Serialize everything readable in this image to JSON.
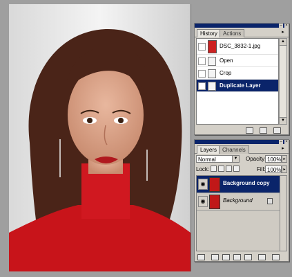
{
  "colors": {
    "accent": "#0a246a",
    "panel_bg": "#d4d0c8",
    "photo_red": "#c01818"
  },
  "document": {
    "image_description_name": "portrait-photo"
  },
  "history": {
    "tabs": [
      {
        "label": "History",
        "active": true
      },
      {
        "label": "Actions",
        "active": false
      }
    ],
    "menu_icon": "menu-arrow-icon",
    "snapshot": {
      "label": "DSC_3832-1.jpg"
    },
    "steps": [
      {
        "label": "Open",
        "selected": false
      },
      {
        "label": "Crop",
        "selected": false
      },
      {
        "label": "Duplicate Layer",
        "selected": true
      }
    ]
  },
  "layers": {
    "tabs": [
      {
        "label": "Layers",
        "active": true
      },
      {
        "label": "Channels",
        "active": false
      }
    ],
    "blend_mode": "Normal",
    "opacity_label": "Opacity:",
    "opacity_value": "100%",
    "lock_label": "Lock:",
    "fill_label": "Fill:",
    "fill_value": "100%",
    "items": [
      {
        "name": "Background copy",
        "selected": true,
        "locked": false
      },
      {
        "name": "Background",
        "selected": false,
        "locked": true
      }
    ]
  }
}
